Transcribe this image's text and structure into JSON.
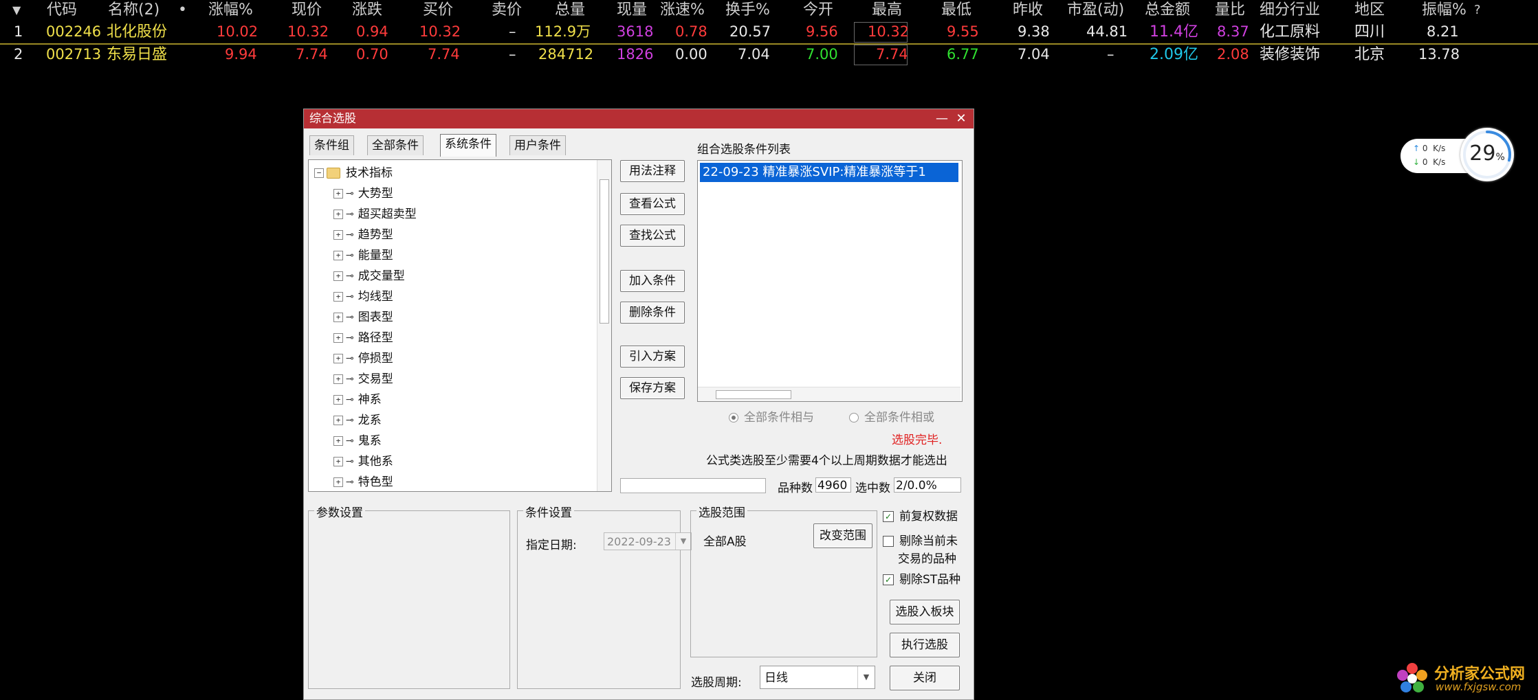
{
  "grid": {
    "sort_icon": "triangle-down-icon",
    "headers": [
      "代码",
      "名称(2)",
      "•",
      "涨幅%",
      "现价",
      "涨跌",
      "买价",
      "卖价",
      "总量",
      "现量",
      "涨速%",
      "换手%",
      "今开",
      "最高",
      "最低",
      "昨收",
      "市盈(动)",
      "总金额",
      "量比",
      "细分行业",
      "地区",
      "振幅%",
      "?"
    ],
    "rows": [
      {
        "idx": "1",
        "code": "002246",
        "name": "北化股份",
        "pct": "10.02",
        "price": "10.32",
        "chg": "0.94",
        "bid": "10.32",
        "ask": "–",
        "vol": "112.9万",
        "curvol": "3618",
        "speed": "0.78",
        "turnover": "20.57",
        "open": "9.56",
        "high": "10.32",
        "low": "9.55",
        "prev": "9.38",
        "pe": "44.81",
        "amount": "11.4亿",
        "volratio": "8.37",
        "industry": "化工原料",
        "region": "四川",
        "amplitude": "8.21"
      },
      {
        "idx": "2",
        "code": "002713",
        "name": "东易日盛",
        "pct": "9.94",
        "price": "7.74",
        "chg": "0.70",
        "bid": "7.74",
        "ask": "–",
        "vol": "284712",
        "curvol": "1826",
        "speed": "0.00",
        "turnover": "7.04",
        "open": "7.00",
        "high": "7.74",
        "low": "6.77",
        "prev": "7.04",
        "pe": "–",
        "amount": "2.09亿",
        "volratio": "2.08",
        "industry": "装修装饰",
        "region": "北京",
        "amplitude": "13.78"
      }
    ],
    "colors": {
      "red": "#ff3b3b",
      "yellow": "#f0e04a",
      "magenta": "#d040e0",
      "cyan": "#20c8e8",
      "green": "#30e030",
      "white": "#e8e8e8",
      "gray": "#cfcfcf"
    }
  },
  "network": {
    "up_arrow": "↑",
    "down_arrow": "↓",
    "up": "0",
    "down": "0",
    "unit": "K/s",
    "cpu_pct": "29",
    "pct_sign": "%"
  },
  "dialog": {
    "title": "综合选股",
    "minimize": "—",
    "close": "✕",
    "tabs": [
      "条件组",
      "全部条件",
      "系统条件",
      "用户条件"
    ],
    "tree": {
      "root": "技术指标",
      "items": [
        "大势型",
        "超买超卖型",
        "趋势型",
        "能量型",
        "成交量型",
        "均线型",
        "图表型",
        "路径型",
        "停损型",
        "交易型",
        "神系",
        "龙系",
        "鬼系",
        "其他系",
        "特色型"
      ]
    },
    "buttons": {
      "usage": "用法注释",
      "view_formula": "查看公式",
      "find_formula": "查找公式",
      "add_condition": "加入条件",
      "delete_condition": "删除条件",
      "import_plan": "引入方案",
      "save_plan": "保存方案",
      "change_range": "改变范围",
      "to_block": "选股入板块",
      "execute": "执行选股",
      "close": "关闭"
    },
    "condition_list": {
      "label": "组合选股条件列表",
      "items": [
        "22-09-23 精准暴涨SVIP:精准暴涨等于1"
      ]
    },
    "radio_and": "全部条件相与",
    "radio_or": "全部条件相或",
    "status": "选股完毕.",
    "hint": "公式类选股至少需要4个以上周期数据才能选出",
    "count_label": "品种数",
    "count_value": "4960",
    "selected_label": "选中数",
    "selected_value": "2/0.0%",
    "param_group": "参数设置",
    "cond_group": "条件设置",
    "date_label": "指定日期:",
    "date_value": "2022-09-23",
    "range_group": "选股范围",
    "range_value": "全部A股",
    "check_adjust": "前复权数据",
    "check_untraded_1": "剔除当前未",
    "check_untraded_2": "交易的品种",
    "check_st": "剔除ST品种",
    "check_mark": "✓",
    "period_label": "选股周期:",
    "period_value": "日线"
  },
  "watermark": {
    "name": "分析家公式网",
    "url": "www.fxjgsw.com"
  }
}
